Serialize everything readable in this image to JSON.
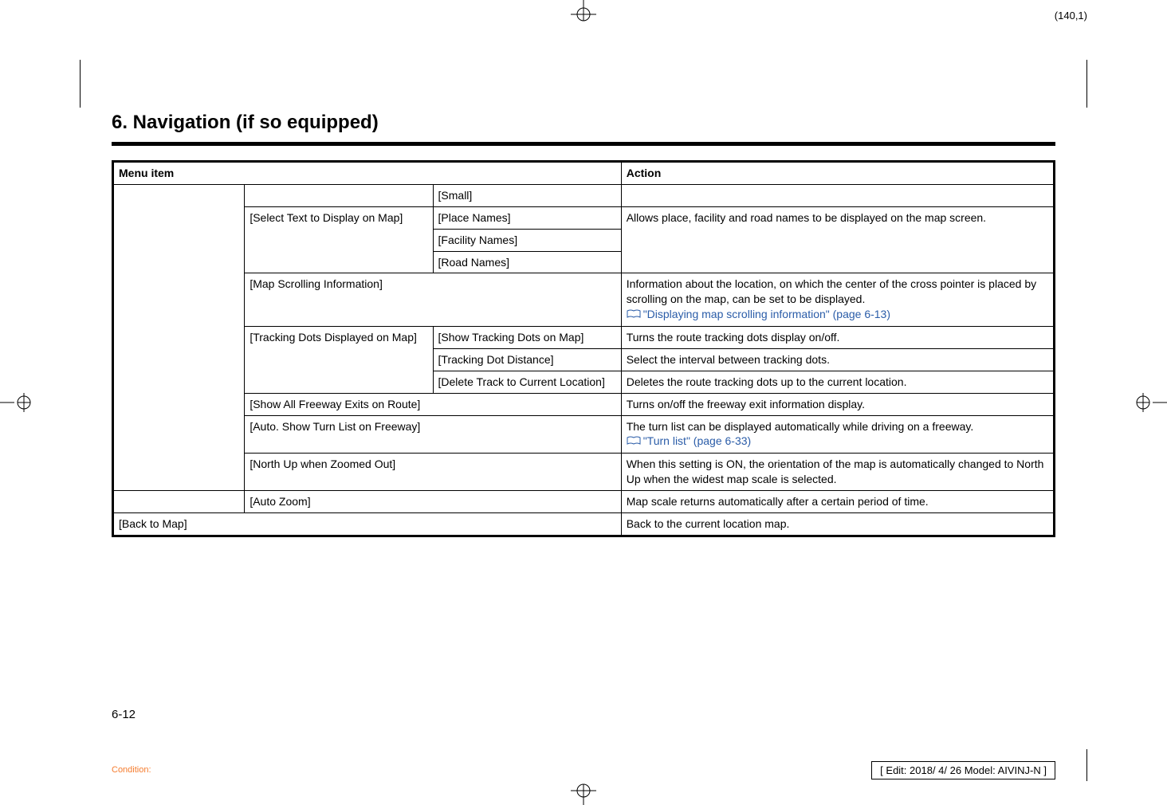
{
  "page_coord": "(140,1)",
  "heading": "6. Navigation (if so equipped)",
  "headers": {
    "menu": "Menu item",
    "action": "Action"
  },
  "rows": {
    "small": {
      "c3": "[Small]",
      "c4": ""
    },
    "select_text": {
      "c2": "[Select Text to Display on Map]",
      "place": "[Place Names]",
      "facility": "[Facility Names]",
      "road": "[Road Names]",
      "action": "Allows place, facility and road names to be displayed on the map screen."
    },
    "map_scroll": {
      "c2": "[Map Scrolling Information]",
      "action_l1": "Information about the location, on which the center of the cross pointer is placed by scrolling on the map, can be set to be displayed.",
      "xref": "\"Displaying map scrolling information\" (page 6-13)"
    },
    "tracking": {
      "c2": "[Tracking Dots Displayed on Map]",
      "show": "[Show Tracking Dots on Map]",
      "show_action": "Turns the route tracking dots display on/off.",
      "dist": "[Tracking Dot Distance]",
      "dist_action": "Select the interval between tracking dots.",
      "del": "[Delete Track to Current Location]",
      "del_action": "Deletes the route tracking dots up to the current location."
    },
    "freeway_exits": {
      "c2": "[Show All Freeway Exits on Route]",
      "action": "Turns on/off the freeway exit information display."
    },
    "auto_turn": {
      "c2": "[Auto. Show Turn List on Freeway]",
      "action_l1": "The turn list can be displayed automatically while driving on a freeway.",
      "xref": "\"Turn list\" (page 6-33)"
    },
    "north_up": {
      "c2": "[North Up when Zoomed Out]",
      "action": "When this setting is ON, the orientation of the map is automatically changed to North Up when the widest map scale is selected."
    },
    "auto_zoom": {
      "c2": "[Auto Zoom]",
      "action": "Map scale returns automatically after a certain period of time."
    },
    "back": {
      "c1": "[Back to Map]",
      "action": "Back to the current location map."
    }
  },
  "page_num": "6-12",
  "condition": "Condition:",
  "edit_box": "[ Edit: 2018/ 4/ 26   Model: AIVINJ-N ]"
}
